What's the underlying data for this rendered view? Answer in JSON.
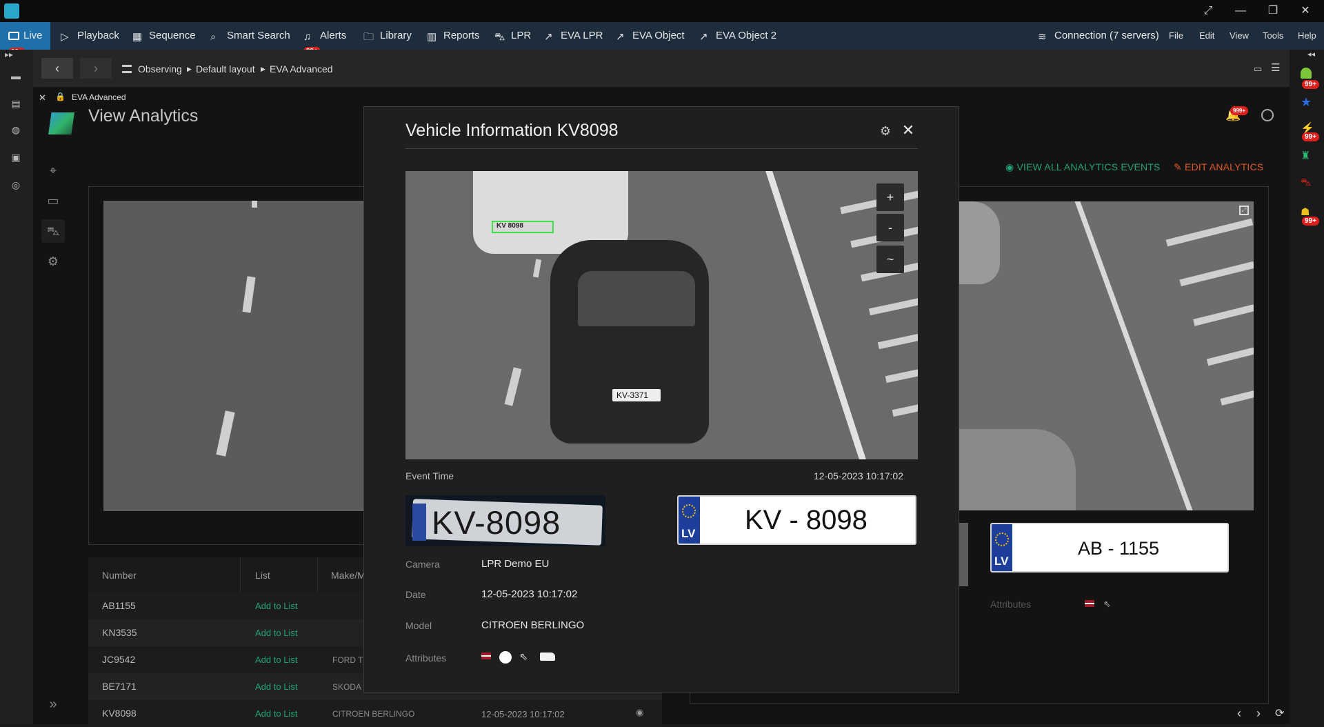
{
  "titlebar": {
    "window_buttons": [
      "expand-icon",
      "minimize-icon",
      "restore-icon",
      "close-icon"
    ]
  },
  "toolbar": {
    "items": [
      {
        "label": "Live",
        "icon": "monitor-icon",
        "badge": "99+"
      },
      {
        "label": "Playback",
        "icon": "play-icon"
      },
      {
        "label": "Sequence",
        "icon": "grid-icon"
      },
      {
        "label": "Smart Search",
        "icon": "search-icon"
      },
      {
        "label": "Alerts",
        "icon": "bell-icon",
        "badge": "99+"
      },
      {
        "label": "Library",
        "icon": "folder-icon"
      },
      {
        "label": "Reports",
        "icon": "bar-chart-icon"
      },
      {
        "label": "LPR",
        "icon": "car-icon"
      },
      {
        "label": "EVA LPR",
        "icon": "external-icon"
      },
      {
        "label": "EVA Object",
        "icon": "external-icon"
      },
      {
        "label": "EVA Object 2",
        "icon": "external-icon"
      }
    ],
    "connection": "Connection (7 servers)",
    "menus": [
      "File",
      "Edit",
      "View",
      "Tools",
      "Help"
    ]
  },
  "nav": {
    "breadcrumb": [
      "Observing",
      "Default layout",
      "EVA Advanced"
    ]
  },
  "panel": {
    "tab_label": "EVA Advanced",
    "title": "View Analytics",
    "notification_badge": "999+",
    "view_all": "VIEW ALL ANALYTICS EVENTS",
    "edit": "EDIT ANALYTICS",
    "right_plate": {
      "country": "LV",
      "number": "AB - 1155"
    },
    "attributes_label": "Attributes"
  },
  "table": {
    "headers": [
      "Number",
      "List",
      "Make/M"
    ],
    "rows": [
      {
        "number": "AB1155",
        "list": "Add to List",
        "make": "",
        "date": ""
      },
      {
        "number": "KN3535",
        "list": "Add to List",
        "make": "",
        "date": ""
      },
      {
        "number": "JC9542",
        "list": "Add to List",
        "make": "FORD T",
        "date": ""
      },
      {
        "number": "BE7171",
        "list": "Add to List",
        "make": "SKODA",
        "date": ""
      },
      {
        "number": "KV8098",
        "list": "Add to List",
        "make": "CITROEN BERLINGO",
        "date": "12-05-2023 10:17:02"
      }
    ]
  },
  "modal": {
    "title": "Vehicle Information KV8098",
    "zoom_in": "+",
    "zoom_out": "-",
    "zoom_fit": "~",
    "snapshot_plates": [
      "KV 8098",
      "KV-3371"
    ],
    "event_time_label": "Event Time",
    "event_time": "12-05-2023 10:17:02",
    "plate_crop_text": "KV-8098",
    "plate": {
      "country": "LV",
      "number": "KV - 8098"
    },
    "fields": [
      {
        "label": "Camera",
        "value": "LPR Demo EU"
      },
      {
        "label": "Date",
        "value": "12-05-2023 10:17:02"
      },
      {
        "label": "Model",
        "value": "CITROEN BERLINGO"
      }
    ],
    "attributes_label": "Attributes",
    "attribute_icons": [
      "latvia-flag-icon",
      "white-color-icon",
      "direction-icon",
      "van-icon"
    ]
  },
  "colors": {
    "toolbar_bg": "#1e2d3b",
    "live_bg": "#1f6fa8",
    "accent_green": "#1fa37a",
    "accent_orange": "#e05a1e",
    "badge_red": "#e0201c"
  }
}
